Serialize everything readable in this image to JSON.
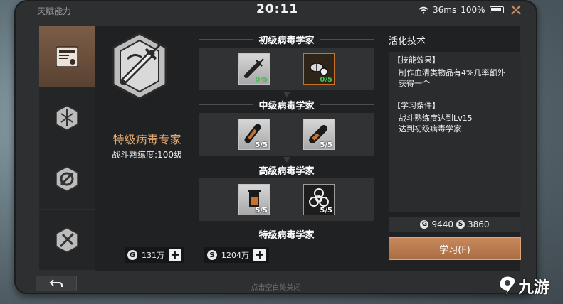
{
  "window": {
    "title": "天赋能力",
    "clock": "20:11",
    "ping": "36ms",
    "battery": "100%"
  },
  "sidebar": {
    "items": [
      {
        "icon": "certificate-icon",
        "active": true
      },
      {
        "icon": "virus-emblem-icon",
        "active": false
      },
      {
        "icon": "gear-wrench-icon",
        "active": false
      },
      {
        "icon": "tools-emblem-icon",
        "active": false
      }
    ]
  },
  "specialty": {
    "name": "特级病毒专家",
    "level": "战斗熟练度:100级"
  },
  "tree": {
    "tiers": [
      {
        "title": "初级病毒学家",
        "skills": [
          {
            "icon": "syringe-icon",
            "count": "0/5"
          },
          {
            "icon": "pills-icon",
            "count": "0/5"
          }
        ]
      },
      {
        "title": "中级病毒学家",
        "skills": [
          {
            "icon": "vial-icon",
            "count": "5/5"
          },
          {
            "icon": "capsule-icon",
            "count": "5/5"
          }
        ]
      },
      {
        "title": "高级病毒学家",
        "skills": [
          {
            "icon": "beaker-icon",
            "count": "5/5"
          },
          {
            "icon": "biohazard-icon",
            "count": "5/5"
          }
        ]
      },
      {
        "title": "特级病毒学家",
        "skills": []
      }
    ]
  },
  "currency": {
    "gold": {
      "symbol": "G",
      "amount": "131万"
    },
    "silver": {
      "symbol": "S",
      "amount": "1204万"
    }
  },
  "detail": {
    "title": "活化技术",
    "effect_header": "【技能效果】",
    "effect_text": "制作血清类物品有4%几率额外获得一个",
    "cond_header": "【学习条件】",
    "cond_line1": "战斗熟练度达到Lv15",
    "cond_line2": "达到初级病毒学家",
    "cost_gold": "9440",
    "cost_silver": "3860",
    "learn_label": "学习(F)"
  },
  "footer": {
    "close_hint": "点击空白处关闭"
  },
  "watermark": {
    "text": "九游"
  },
  "colors": {
    "accent": "#c8885a",
    "spec_name": "#e2a770",
    "progress_green": "#3fc44f"
  }
}
